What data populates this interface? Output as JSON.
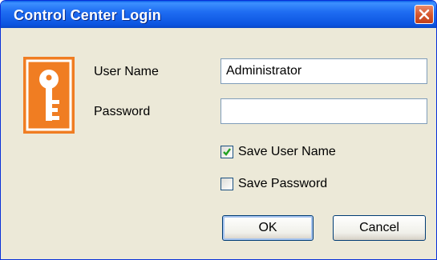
{
  "window": {
    "title": "Control Center Login"
  },
  "form": {
    "user_name_label": "User Name",
    "user_name_value": "Administrator",
    "password_label": "Password",
    "password_value": "",
    "save_user_name": {
      "label": "Save User Name",
      "checked": true
    },
    "save_password": {
      "label": "Save Password",
      "checked": false
    }
  },
  "buttons": {
    "ok": "OK",
    "cancel": "Cancel"
  },
  "icons": {
    "logo": "key-icon",
    "close": "close-icon",
    "check": "checkmark-icon"
  },
  "colors": {
    "titlebar": "#0b54e0",
    "accent": "#f07d22",
    "close": "#d4552c",
    "checkmark": "#21a121"
  }
}
